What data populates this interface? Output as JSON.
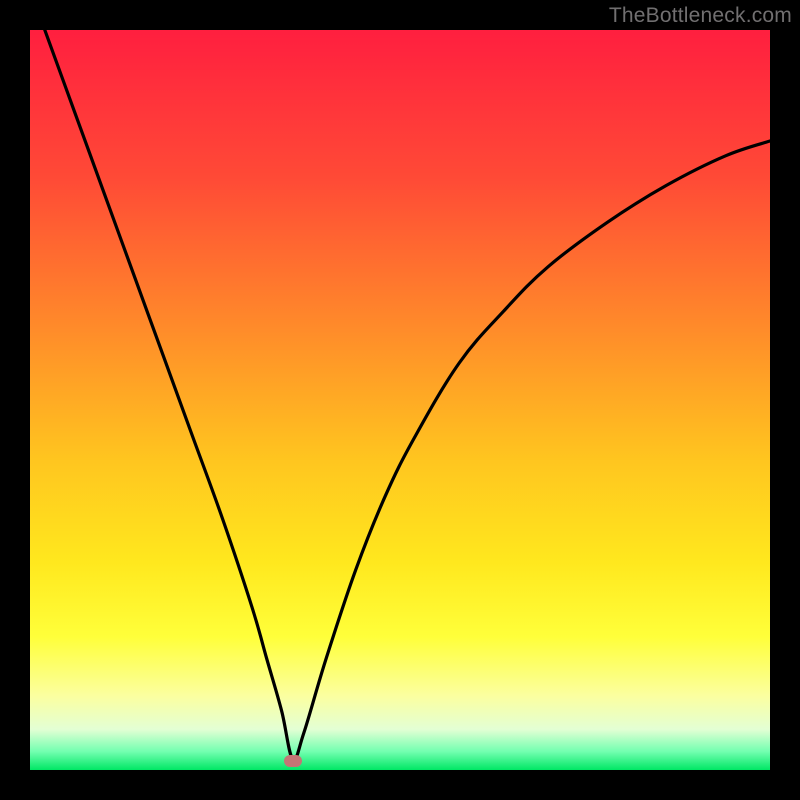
{
  "attribution": "TheBottleneck.com",
  "colors": {
    "frame": "#000000",
    "gradient_stops": [
      {
        "pos": 0.0,
        "color": "#ff1f3f"
      },
      {
        "pos": 0.2,
        "color": "#ff4a36"
      },
      {
        "pos": 0.4,
        "color": "#ff8a2a"
      },
      {
        "pos": 0.58,
        "color": "#ffc51f"
      },
      {
        "pos": 0.72,
        "color": "#ffe81e"
      },
      {
        "pos": 0.82,
        "color": "#ffff3a"
      },
      {
        "pos": 0.9,
        "color": "#fbffa0"
      },
      {
        "pos": 0.945,
        "color": "#e3ffd4"
      },
      {
        "pos": 0.975,
        "color": "#73ffb0"
      },
      {
        "pos": 1.0,
        "color": "#00e765"
      }
    ],
    "curve": "#000000",
    "marker": "#c47575"
  },
  "chart_data": {
    "type": "line",
    "title": "",
    "xlabel": "",
    "ylabel": "",
    "xlim": [
      0,
      100
    ],
    "ylim": [
      0,
      100
    ],
    "grid": false,
    "series": [
      {
        "name": "bottleneck-curve",
        "x": [
          2,
          6,
          10,
          14,
          18,
          22,
          26,
          30,
          32,
          34,
          35.5,
          37,
          40,
          44,
          48,
          52,
          58,
          64,
          70,
          78,
          86,
          94,
          100
        ],
        "y": [
          100,
          89,
          78,
          67,
          56,
          45,
          34,
          22,
          15,
          8,
          1.5,
          5,
          15,
          27,
          37,
          45,
          55,
          62,
          68,
          74,
          79,
          83,
          85
        ]
      }
    ],
    "marker": {
      "x": 35.5,
      "y": 1.2
    }
  }
}
